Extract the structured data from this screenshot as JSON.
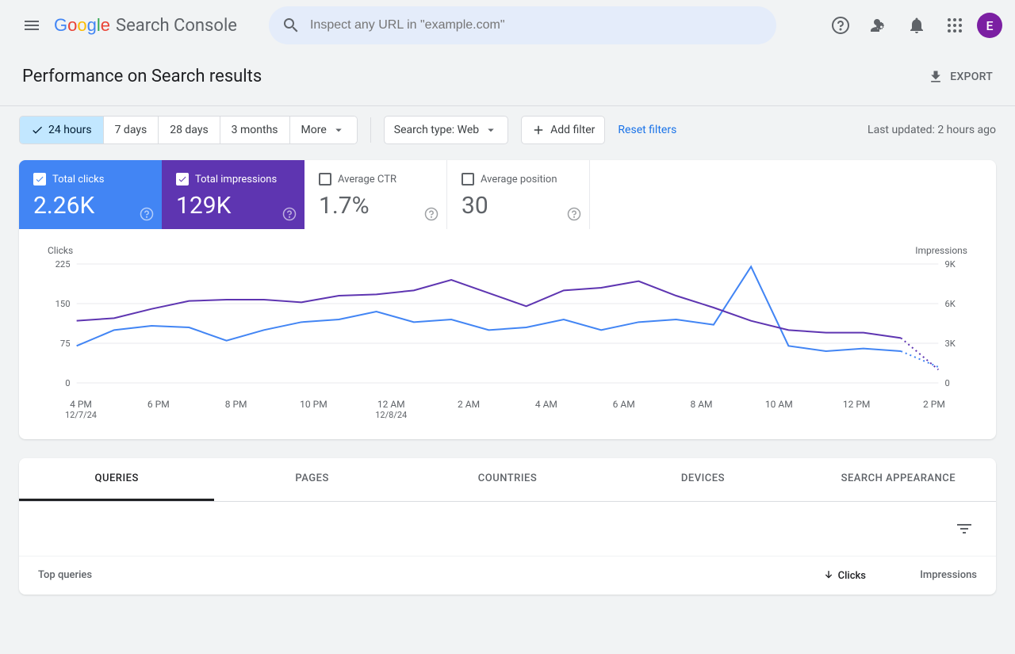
{
  "header": {
    "product_name": "Search Console",
    "search_placeholder": "Inspect any URL in \"example.com\"",
    "avatar_letter": "E"
  },
  "page": {
    "title": "Performance on Search results",
    "export_label": "EXPORT"
  },
  "filters": {
    "ranges": [
      "24 hours",
      "7 days",
      "28 days",
      "3 months",
      "More"
    ],
    "active_range_index": 0,
    "search_type_label": "Search type: Web",
    "add_filter_label": "Add filter",
    "reset_label": "Reset filters",
    "last_updated": "Last updated: 2 hours ago"
  },
  "metrics": {
    "clicks": {
      "label": "Total clicks",
      "value": "2.26K",
      "checked": true
    },
    "impressions": {
      "label": "Total impressions",
      "value": "129K",
      "checked": true
    },
    "ctr": {
      "label": "Average CTR",
      "value": "1.7%",
      "checked": false
    },
    "position": {
      "label": "Average position",
      "value": "30",
      "checked": false
    }
  },
  "chart_data": {
    "type": "line",
    "left_axis_label": "Clicks",
    "right_axis_label": "Impressions",
    "left_ticks": [
      0,
      75,
      150,
      225
    ],
    "right_ticks": [
      0,
      "3K",
      "6K",
      "9K"
    ],
    "x_labels": [
      {
        "time": "4 PM",
        "date": "12/7/24"
      },
      {
        "time": "6 PM"
      },
      {
        "time": "8 PM"
      },
      {
        "time": "10 PM"
      },
      {
        "time": "12 AM",
        "date": "12/8/24"
      },
      {
        "time": "2 AM"
      },
      {
        "time": "4 AM"
      },
      {
        "time": "6 AM"
      },
      {
        "time": "8 AM"
      },
      {
        "time": "10 AM"
      },
      {
        "time": "12 PM"
      },
      {
        "time": "2 PM"
      }
    ],
    "series": [
      {
        "name": "Clicks",
        "color": "#4285f4",
        "axis": "left",
        "values": [
          70,
          100,
          108,
          105,
          80,
          100,
          115,
          120,
          135,
          115,
          120,
          100,
          105,
          120,
          100,
          115,
          120,
          110,
          220,
          70,
          60,
          65,
          60,
          30
        ]
      },
      {
        "name": "Impressions",
        "color": "#5e35b1",
        "axis": "right",
        "values": [
          4700,
          4900,
          5600,
          6200,
          6300,
          6300,
          6100,
          6600,
          6700,
          7000,
          7800,
          6800,
          5800,
          7000,
          7200,
          7700,
          6600,
          5700,
          4700,
          4000,
          3800,
          3800,
          3400,
          1000
        ]
      }
    ],
    "projected_from_index": 22
  },
  "tabs": {
    "items": [
      "QUERIES",
      "PAGES",
      "COUNTRIES",
      "DEVICES",
      "SEARCH APPEARANCE"
    ],
    "active_index": 0
  },
  "table": {
    "col_queries": "Top queries",
    "col_clicks": "Clicks",
    "col_impressions": "Impressions"
  }
}
